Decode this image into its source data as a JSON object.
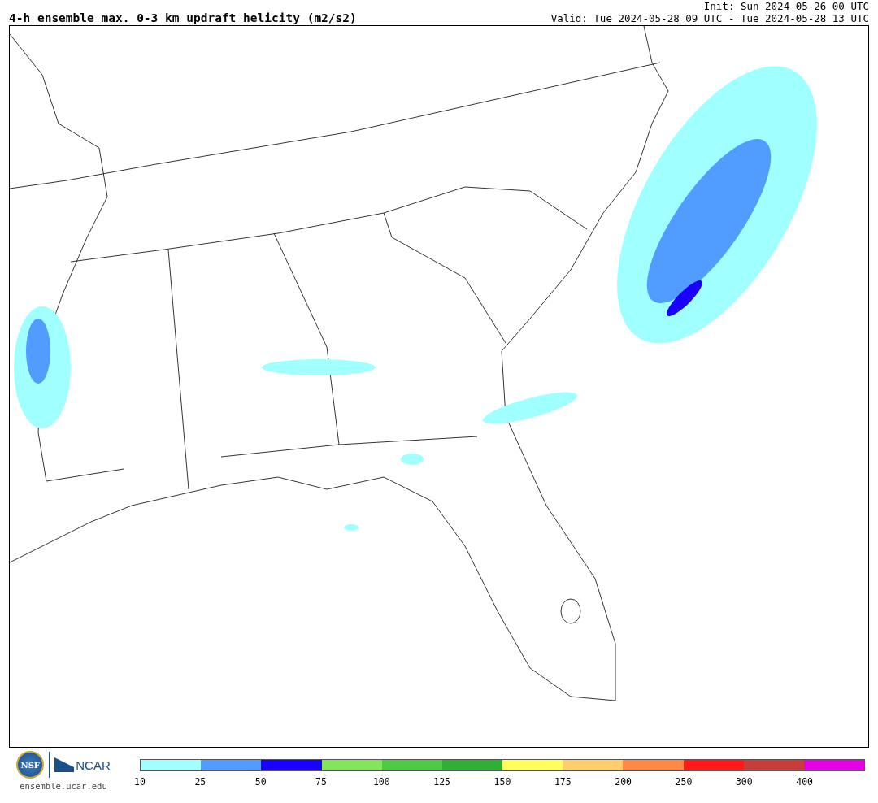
{
  "title": "4-h ensemble max. 0-3 km updraft helicity (m2/s2)",
  "init": "Init: Sun 2024-05-26 00 UTC",
  "valid": "Valid: Tue 2024-05-28 09 UTC - Tue 2024-05-28 13 UTC",
  "logos": {
    "nsf": "NSF",
    "ncar": "NCAR",
    "url": "ensemble.ucar.edu"
  },
  "colorbar": {
    "bins": [
      {
        "color": "#a0ffff"
      },
      {
        "color": "#509cff"
      },
      {
        "color": "#1a00ff"
      },
      {
        "color": "#82e55a"
      },
      {
        "color": "#4ccb43"
      },
      {
        "color": "#2eb035"
      },
      {
        "color": "#ffff5a"
      },
      {
        "color": "#ffcd6a"
      },
      {
        "color": "#ff8845"
      },
      {
        "color": "#ff1a1a"
      },
      {
        "color": "#c83c3c"
      },
      {
        "color": "#e600e6"
      }
    ],
    "ticks": [
      "10",
      "25",
      "50",
      "75",
      "100",
      "125",
      "150",
      "175",
      "200",
      "250",
      "300",
      "400"
    ]
  }
}
